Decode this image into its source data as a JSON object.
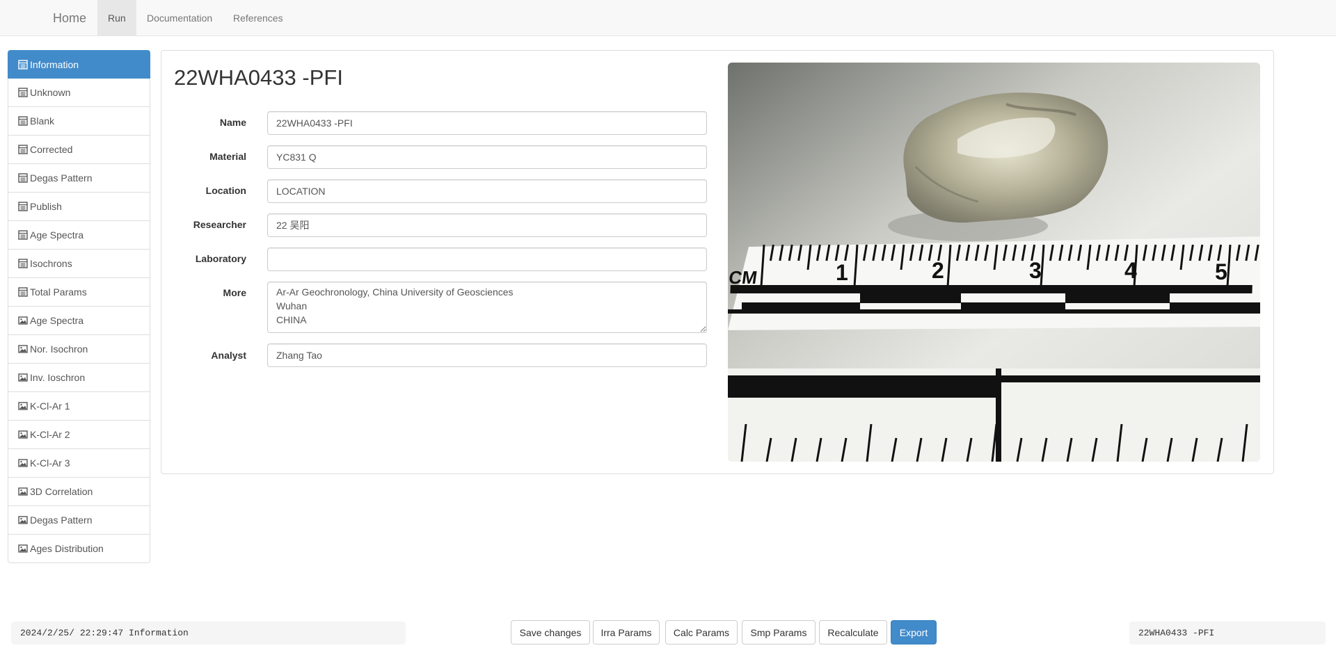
{
  "navbar": {
    "brand": "Home",
    "items": [
      {
        "label": "Run",
        "active": true
      },
      {
        "label": "Documentation",
        "active": false
      },
      {
        "label": "References",
        "active": false
      }
    ]
  },
  "sidebar": {
    "items": [
      {
        "label": "Information",
        "icon": "table-icon",
        "active": true
      },
      {
        "label": "Unknown",
        "icon": "table-icon"
      },
      {
        "label": "Blank",
        "icon": "table-icon"
      },
      {
        "label": "Corrected",
        "icon": "table-icon"
      },
      {
        "label": "Degas Pattern",
        "icon": "table-icon"
      },
      {
        "label": "Publish",
        "icon": "table-icon"
      },
      {
        "label": "Age Spectra",
        "icon": "table-icon"
      },
      {
        "label": "Isochrons",
        "icon": "table-icon"
      },
      {
        "label": "Total Params",
        "icon": "table-icon"
      },
      {
        "label": "Age Spectra",
        "icon": "picture-icon"
      },
      {
        "label": "Nor. Isochron",
        "icon": "picture-icon"
      },
      {
        "label": "Inv. Ioschron",
        "icon": "picture-icon"
      },
      {
        "label": "K-Cl-Ar 1",
        "icon": "picture-icon"
      },
      {
        "label": "K-Cl-Ar 2",
        "icon": "picture-icon"
      },
      {
        "label": "K-Cl-Ar 3",
        "icon": "picture-icon"
      },
      {
        "label": "3D Correlation",
        "icon": "picture-icon"
      },
      {
        "label": "Degas Pattern",
        "icon": "picture-icon"
      },
      {
        "label": "Ages Distribution",
        "icon": "picture-icon"
      }
    ]
  },
  "main": {
    "title": "22WHA0433 -PFI",
    "fields": {
      "name": {
        "label": "Name",
        "value": "22WHA0433 -PFI"
      },
      "material": {
        "label": "Material",
        "value": "YC831 Q"
      },
      "location": {
        "label": "Location",
        "value": "LOCATION"
      },
      "researcher": {
        "label": "Researcher",
        "value": "22 吴阳"
      },
      "laboratory": {
        "label": "Laboratory",
        "value": ""
      },
      "more": {
        "label": "More",
        "value": "Ar-Ar Geochronology, China University of Geosciences\nWuhan\nCHINA"
      },
      "analyst": {
        "label": "Analyst",
        "value": "Zhang Tao"
      }
    },
    "photo": {
      "ruler_labels": [
        "CM",
        "1",
        "2",
        "3",
        "4",
        "5"
      ]
    }
  },
  "footer": {
    "status_log": "2024/2/25/ 22:29:47 Information",
    "buttons": {
      "save": "Save changes",
      "irra": "Irra Params",
      "calc": "Calc Params",
      "smp": "Smp Params",
      "recalc": "Recalculate",
      "export": "Export"
    },
    "current_sample": "22WHA0433 -PFI"
  },
  "colors": {
    "accent": "#428bca",
    "navbar_bg": "#f8f8f8"
  }
}
